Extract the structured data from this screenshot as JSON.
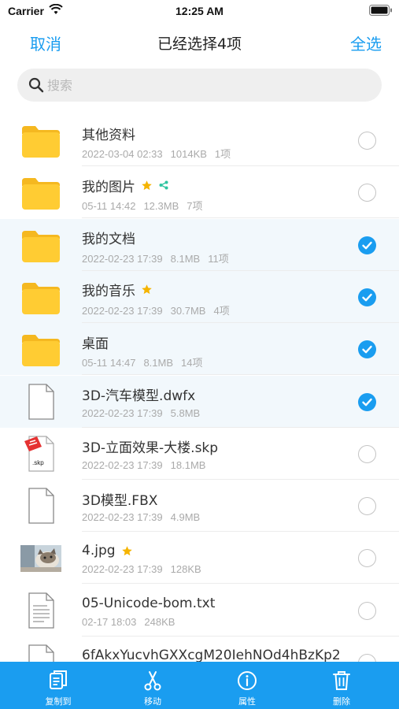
{
  "status_bar": {
    "carrier": "Carrier",
    "time": "12:25 AM"
  },
  "nav": {
    "cancel": "取消",
    "title": "已经选择4项",
    "select_all": "全选"
  },
  "search": {
    "placeholder": "搜索"
  },
  "colors": {
    "accent": "#1a9df0",
    "folder": "#ffcc33",
    "star": "#f5b400",
    "share": "#2ec4a0",
    "selected_row": "#f2f8fc"
  },
  "files": [
    {
      "name": "其他资料",
      "date": "2022-03-04 02:33",
      "size": "1014KB",
      "count": "1项",
      "icon": "folder-icon",
      "starred": false,
      "shared": false,
      "selected": false
    },
    {
      "name": "我的图片",
      "date": "05-11 14:42",
      "size": "12.3MB",
      "count": "7项",
      "icon": "folder-icon",
      "starred": true,
      "shared": true,
      "selected": false
    },
    {
      "name": "我的文档",
      "date": "2022-02-23 17:39",
      "size": "8.1MB",
      "count": "11项",
      "icon": "folder-icon",
      "starred": false,
      "shared": false,
      "selected": true
    },
    {
      "name": "我的音乐",
      "date": "2022-02-23 17:39",
      "size": "30.7MB",
      "count": "4项",
      "icon": "folder-icon",
      "starred": true,
      "shared": false,
      "selected": true
    },
    {
      "name": "桌面",
      "date": "05-11 14:47",
      "size": "8.1MB",
      "count": "14项",
      "icon": "folder-icon",
      "starred": false,
      "shared": false,
      "selected": true
    },
    {
      "name": "3D-汽车模型.dwfx",
      "date": "2022-02-23 17:39",
      "size": "5.8MB",
      "count": "",
      "icon": "file-icon",
      "starred": false,
      "shared": false,
      "selected": true
    },
    {
      "name": "3D-立面效果-大楼.skp",
      "date": "2022-02-23 17:39",
      "size": "18.1MB",
      "count": "",
      "icon": "skp-file-icon",
      "starred": false,
      "shared": false,
      "selected": false
    },
    {
      "name": "3D模型.FBX",
      "date": "2022-02-23 17:39",
      "size": "4.9MB",
      "count": "",
      "icon": "file-icon",
      "starred": false,
      "shared": false,
      "selected": false
    },
    {
      "name": "4.jpg",
      "date": "2022-02-23 17:39",
      "size": "128KB",
      "count": "",
      "icon": "cat-photo-thumbnail",
      "starred": true,
      "shared": false,
      "selected": false
    },
    {
      "name": "05-Unicode-bom.txt",
      "date": "02-17 18:03",
      "size": "248KB",
      "count": "",
      "icon": "text-file-icon",
      "starred": false,
      "shared": false,
      "selected": false
    },
    {
      "name": "6fAkxYucvhGXXcgM20IehNOd4hBzKp2",
      "date": "",
      "size": "",
      "count": "",
      "icon": "file-icon",
      "starred": false,
      "shared": false,
      "selected": false
    }
  ],
  "toolbar": [
    {
      "label": "复制到",
      "icon": "copy-icon"
    },
    {
      "label": "移动",
      "icon": "scissors-icon"
    },
    {
      "label": "属性",
      "icon": "info-icon"
    },
    {
      "label": "删除",
      "icon": "trash-icon"
    }
  ]
}
